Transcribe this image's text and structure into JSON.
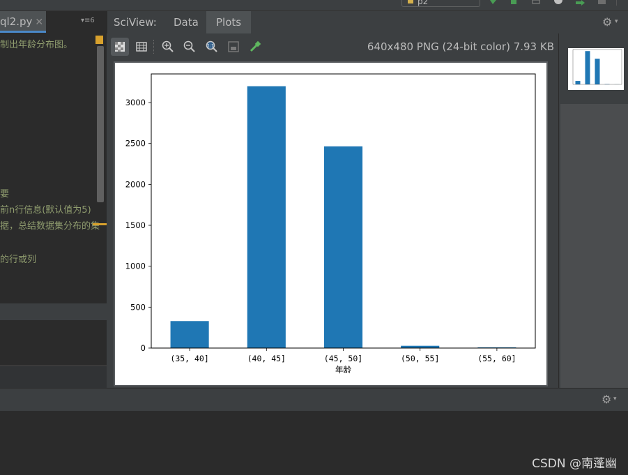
{
  "toolbar": {
    "run_config": "p2",
    "accent_color": "#4a88c7"
  },
  "editor": {
    "tab_label": "ql2.py",
    "tab_close": "✕",
    "tab_menu": "▾≡6",
    "lines": [
      "制出年龄分布图。",
      "要",
      "前n行信息(默认值为5)",
      "据，总结数据集分布的集",
      "的行或列"
    ]
  },
  "sciview": {
    "label": "SciView:",
    "tabs": [
      "Data",
      "Plots"
    ],
    "active_tab": "Plots",
    "image_info": "640x480 PNG (24-bit color) 7.93 KB"
  },
  "plot_toolbar": {
    "icons": [
      "chessboard-icon",
      "grid-icon",
      "zoom-in-icon",
      "zoom-out-icon",
      "actual-size-icon",
      "fit-icon",
      "color-picker-icon"
    ]
  },
  "chart_data": {
    "type": "bar",
    "categories": [
      "(35, 40]",
      "(40, 45]",
      "(45, 50]",
      "(50, 55]",
      "(55, 60]"
    ],
    "values": [
      330,
      3200,
      2465,
      28,
      8
    ],
    "xlabel": "年龄",
    "ylabel": "",
    "ylim": [
      0,
      3350
    ],
    "yticks": [
      0,
      500,
      1000,
      1500,
      2000,
      2500,
      3000
    ],
    "bar_color": "#1f77b4",
    "grid": false
  },
  "watermark": "CSDN @南蓬幽"
}
